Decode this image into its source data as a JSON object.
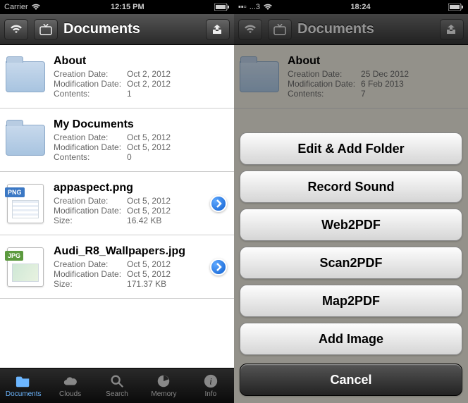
{
  "left": {
    "status": {
      "carrier": "Carrier",
      "wifi": "wifi",
      "time": "12:15 PM",
      "batt": "batt"
    },
    "nav": {
      "title": "Documents"
    },
    "rows": [
      {
        "kind": "folder",
        "title": "About",
        "created_label": "Creation Date:",
        "created": "Oct 2, 2012",
        "mod_label": "Modification Date:",
        "mod": "Oct 2, 2012",
        "contents_label": "Contents:",
        "contents": "1",
        "disclosure": false
      },
      {
        "kind": "folder",
        "title": "My Documents",
        "created_label": "Creation Date:",
        "created": "Oct 5, 2012",
        "mod_label": "Modification Date:",
        "mod": "Oct 5, 2012",
        "contents_label": "Contents:",
        "contents": "0",
        "disclosure": false
      },
      {
        "kind": "png",
        "title": "appaspect.png",
        "created_label": "Creation Date:",
        "created": "Oct 5, 2012",
        "mod_label": "Modification Date:",
        "mod": "Oct 5, 2012",
        "size_label": "Size:",
        "size": "16.42 KB",
        "disclosure": true,
        "tag": "PNG",
        "tag_color": "#3b78c4"
      },
      {
        "kind": "jpg",
        "title": "Audi_R8_Wallpapers.jpg",
        "created_label": "Creation Date:",
        "created": "Oct 5, 2012",
        "mod_label": "Modification Date:",
        "mod": "Oct 5, 2012",
        "size_label": "Size:",
        "size": "171.37 KB",
        "disclosure": true,
        "tag": "JPG",
        "tag_color": "#5c9a3f"
      }
    ],
    "tabs": [
      {
        "label": "Documents",
        "icon": "folder",
        "active": true
      },
      {
        "label": "Clouds",
        "icon": "cloud",
        "active": false
      },
      {
        "label": "Search",
        "icon": "search",
        "active": false
      },
      {
        "label": "Memory",
        "icon": "pie",
        "active": false
      },
      {
        "label": "Info",
        "icon": "info",
        "active": false
      }
    ]
  },
  "right": {
    "status": {
      "carrier": "...3",
      "wifi": "wifi",
      "time": "18:24",
      "batt": "batt"
    },
    "nav": {
      "title": "Documents"
    },
    "bgrow": {
      "title": "About",
      "created_label": "Creation Date:",
      "created": "25 Dec 2012",
      "mod_label": "Modification Date:",
      "mod": "6 Feb 2013",
      "contents_label": "Contents:",
      "contents": "7"
    },
    "actions": [
      "Edit & Add Folder",
      "Record Sound",
      "Web2PDF",
      "Scan2PDF",
      "Map2PDF",
      "Add Image"
    ],
    "cancel": "Cancel"
  }
}
